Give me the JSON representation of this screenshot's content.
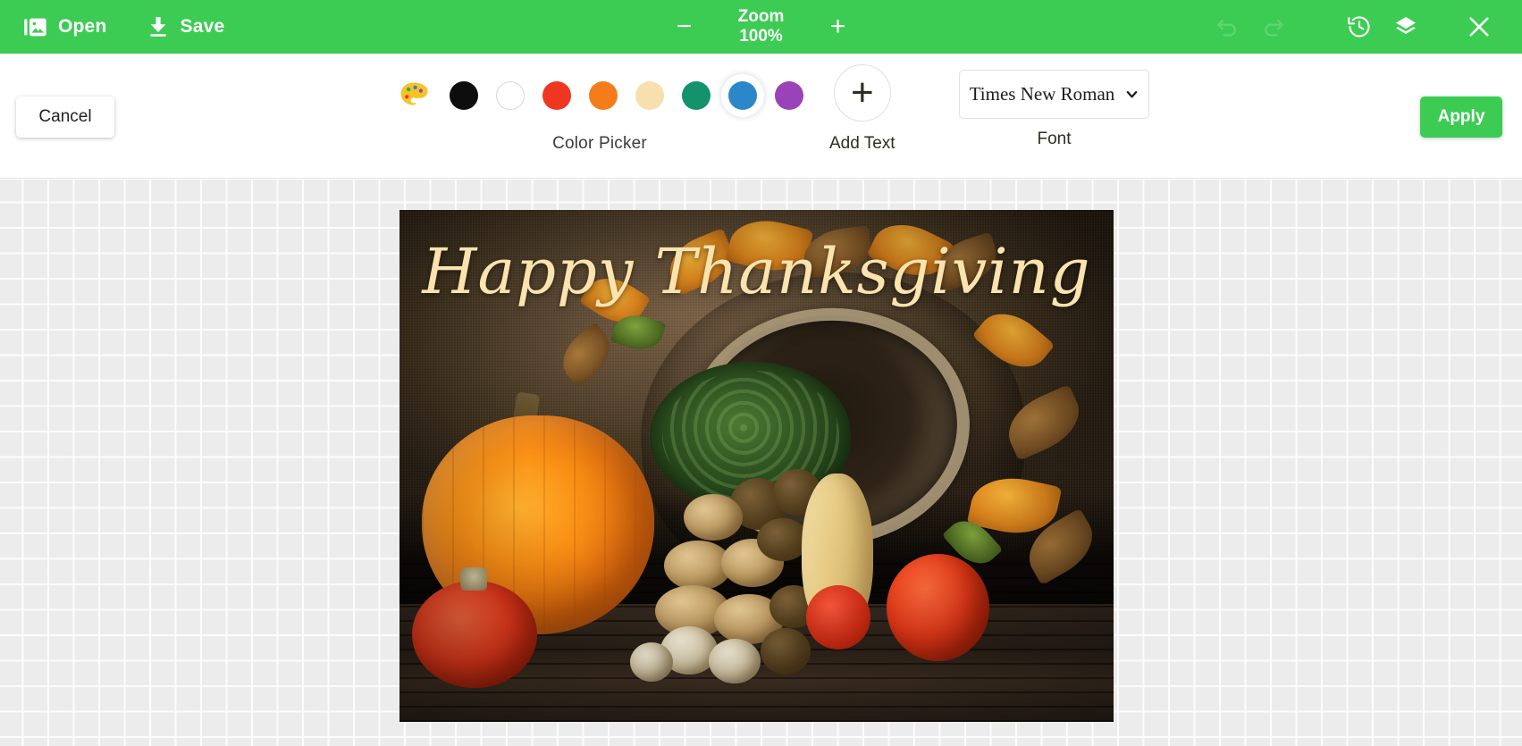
{
  "topbar": {
    "background": "#3ccc53",
    "open_label": "Open",
    "open_icon": "image-library-icon",
    "save_label": "Save",
    "save_icon": "download-icon",
    "zoom_out_label": "−",
    "zoom_title": "Zoom",
    "zoom_value": "100%",
    "zoom_in_label": "+",
    "undo_icon": "undo-arrow-icon",
    "redo_icon": "redo-arrow-icon",
    "history_icon": "history-clock-icon",
    "layers_icon": "layers-icon",
    "close_icon": "close-x-icon"
  },
  "toolbar": {
    "cancel_label": "Cancel",
    "apply_label": "Apply",
    "apply_color": "#3ccc53",
    "color_picker": {
      "label": "Color Picker",
      "palette_icon": "color-palette-icon",
      "selected": "#2b87c9",
      "swatches": [
        {
          "name": "black",
          "hex": "#0d0d0d"
        },
        {
          "name": "white",
          "hex": "#ffffff"
        },
        {
          "name": "red",
          "hex": "#ef3620"
        },
        {
          "name": "orange",
          "hex": "#f57c1b"
        },
        {
          "name": "cream",
          "hex": "#f7e0ae"
        },
        {
          "name": "teal",
          "hex": "#13926b"
        },
        {
          "name": "blue",
          "hex": "#2b87c9"
        },
        {
          "name": "purple",
          "hex": "#9a42b8"
        }
      ]
    },
    "add_text": {
      "label": "Add Text",
      "icon": "plus-icon"
    },
    "font": {
      "label": "Font",
      "selected": "Times New Roman",
      "chevron_icon": "chevron-down-icon"
    }
  },
  "canvas": {
    "background": "checkerboard-grid",
    "image": {
      "alt": "Thanksgiving cornucopia basket with pumpkin, cabbage, squash and root vegetables on a wooden table",
      "overlay_text": "Happy Thanksgiving",
      "overlay_text_color": "#fbe3ae"
    }
  }
}
